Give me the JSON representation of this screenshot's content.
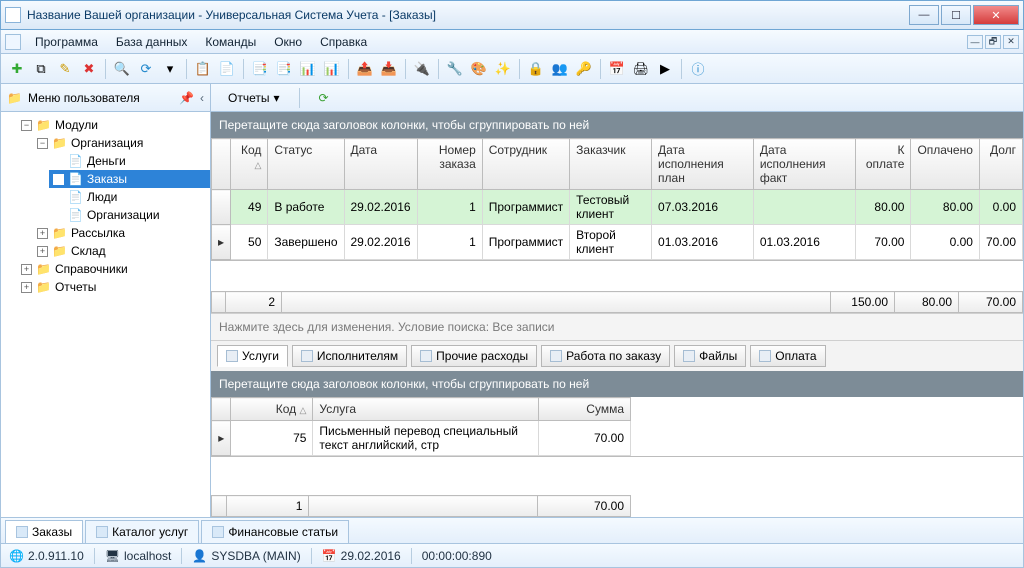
{
  "window": {
    "title": "Название Вашей организации - Универсальная Система Учета - [Заказы]"
  },
  "menus": [
    "Программа",
    "База данных",
    "Команды",
    "Окно",
    "Справка"
  ],
  "usermenu_label": "Меню пользователя",
  "reports_button": "Отчеты",
  "tree": {
    "root": "Модули",
    "org": "Организация",
    "org_children": [
      "Деньги",
      "Заказы",
      "Люди",
      "Организации"
    ],
    "mailing": "Рассылка",
    "stock": "Склад",
    "refs": "Справочники",
    "reports": "Отчеты"
  },
  "main_grid": {
    "group_hint": "Перетащите сюда заголовок колонки, чтобы сгруппировать по ней",
    "cols": [
      "Код",
      "Статус",
      "Дата",
      "Номер заказа",
      "Сотрудник",
      "Заказчик",
      "Дата исполнения план",
      "Дата исполнения факт",
      "К оплате",
      "Оплачено",
      "Долг"
    ],
    "rows": [
      {
        "code": "49",
        "status": "В работе",
        "date": "29.02.2016",
        "num": "1",
        "emp": "Программист",
        "cust": "Тестовый клиент",
        "plan": "07.03.2016",
        "fact": "",
        "pay": "80.00",
        "paid": "80.00",
        "debt": "0.00",
        "hl": true
      },
      {
        "code": "50",
        "status": "Завершено",
        "date": "29.02.2016",
        "num": "1",
        "emp": "Программист",
        "cust": "Второй клиент",
        "plan": "01.03.2016",
        "fact": "01.03.2016",
        "pay": "70.00",
        "paid": "0.00",
        "debt": "70.00",
        "hl": false
      }
    ],
    "footer": {
      "count": "2",
      "pay": "150.00",
      "paid": "80.00",
      "debt": "70.00"
    }
  },
  "search_hint": "Нажмите здесь для изменения. Условие поиска: Все записи",
  "sub_tabs": [
    "Услуги",
    "Исполнителям",
    "Прочие расходы",
    "Работа по заказу",
    "Файлы",
    "Оплата"
  ],
  "detail_grid": {
    "group_hint": "Перетащите сюда заголовок колонки, чтобы сгруппировать по ней",
    "cols": [
      "Код",
      "Услуга",
      "Сумма"
    ],
    "rows": [
      {
        "code": "75",
        "service": "Письменный перевод специальный текст английский, стр",
        "sum": "70.00"
      }
    ],
    "footer": {
      "count": "1",
      "sum": "70.00"
    }
  },
  "bottom_tabs": [
    "Заказы",
    "Каталог услуг",
    "Финансовые статьи"
  ],
  "status": {
    "version": "2.0.911.10",
    "host": "localhost",
    "user": "SYSDBA (MAIN)",
    "date": "29.02.2016",
    "time": "00:00:00:890"
  }
}
